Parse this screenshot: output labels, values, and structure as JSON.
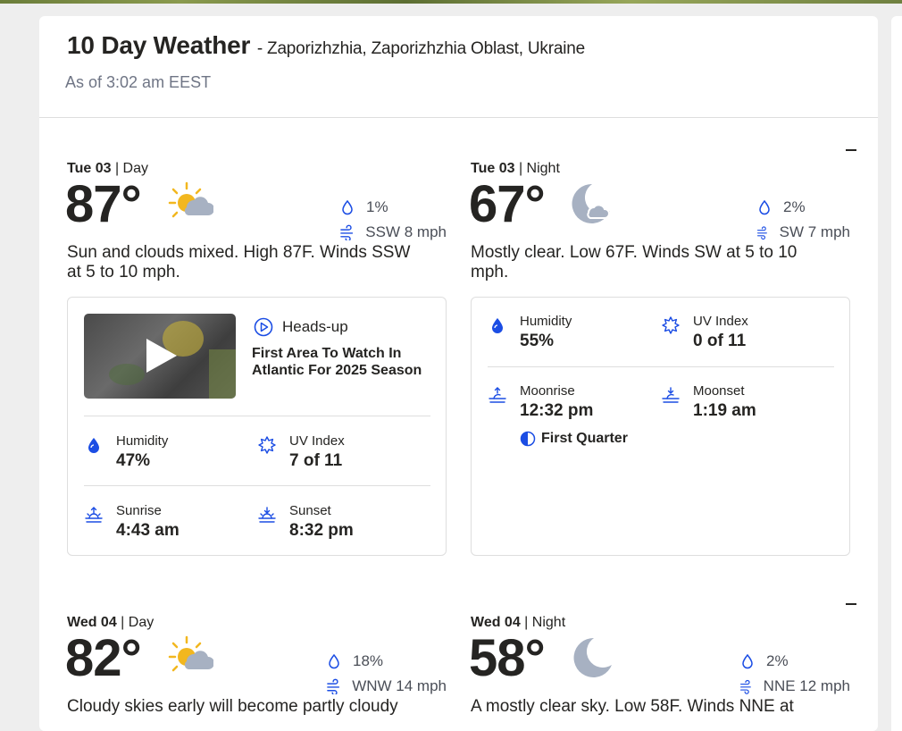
{
  "header": {
    "title": "10 Day Weather",
    "location": "- Zaporizhzhia, Zaporizhzhia Oblast, Ukraine",
    "as_of": "As of 3:02 am EEST"
  },
  "days": [
    {
      "day_part": {
        "date": "Tue 03",
        "period": "Day",
        "temp": "87°",
        "icon": "sun-cloud-icon",
        "precip": "1%",
        "wind": "SSW 8 mph",
        "description": "Sun and clouds mixed. High 87F. Winds SSW at 5 to 10 mph.",
        "headsup": {
          "label": "Heads-up",
          "title": "First Area To Watch In Atlantic For 2025 Season"
        },
        "humidity_label": "Humidity",
        "humidity": "47%",
        "uv_label": "UV Index",
        "uv": "7 of 11",
        "sunrise_label": "Sunrise",
        "sunrise": "4:43 am",
        "sunset_label": "Sunset",
        "sunset": "8:32 pm"
      },
      "night_part": {
        "date": "Tue 03",
        "period": "Night",
        "temp": "67°",
        "icon": "moon-cloud-icon",
        "precip": "2%",
        "wind": "SW 7 mph",
        "description": "Mostly clear. Low 67F. Winds SW at 5 to 10 mph.",
        "humidity_label": "Humidity",
        "humidity": "55%",
        "uv_label": "UV Index",
        "uv": "0 of 11",
        "moonrise_label": "Moonrise",
        "moonrise": "12:32 pm",
        "moonset_label": "Moonset",
        "moonset": "1:19 am",
        "moon_phase": "First Quarter"
      }
    },
    {
      "day_part": {
        "date": "Wed 04",
        "period": "Day",
        "temp": "82°",
        "icon": "sun-cloud-icon",
        "precip": "18%",
        "wind": "WNW 14 mph",
        "description": "Cloudy skies early will become partly cloudy"
      },
      "night_part": {
        "date": "Wed 04",
        "period": "Night",
        "temp": "58°",
        "icon": "moon-icon",
        "precip": "2%",
        "wind": "NNE 12 mph",
        "description": "A mostly clear sky. Low 58F. Winds NNE at"
      }
    }
  ],
  "colors": {
    "accent": "#1b4de4",
    "sun": "#f2b71f",
    "cloud": "#a7b1c2",
    "text": "#252422",
    "muted": "#6f7585"
  }
}
